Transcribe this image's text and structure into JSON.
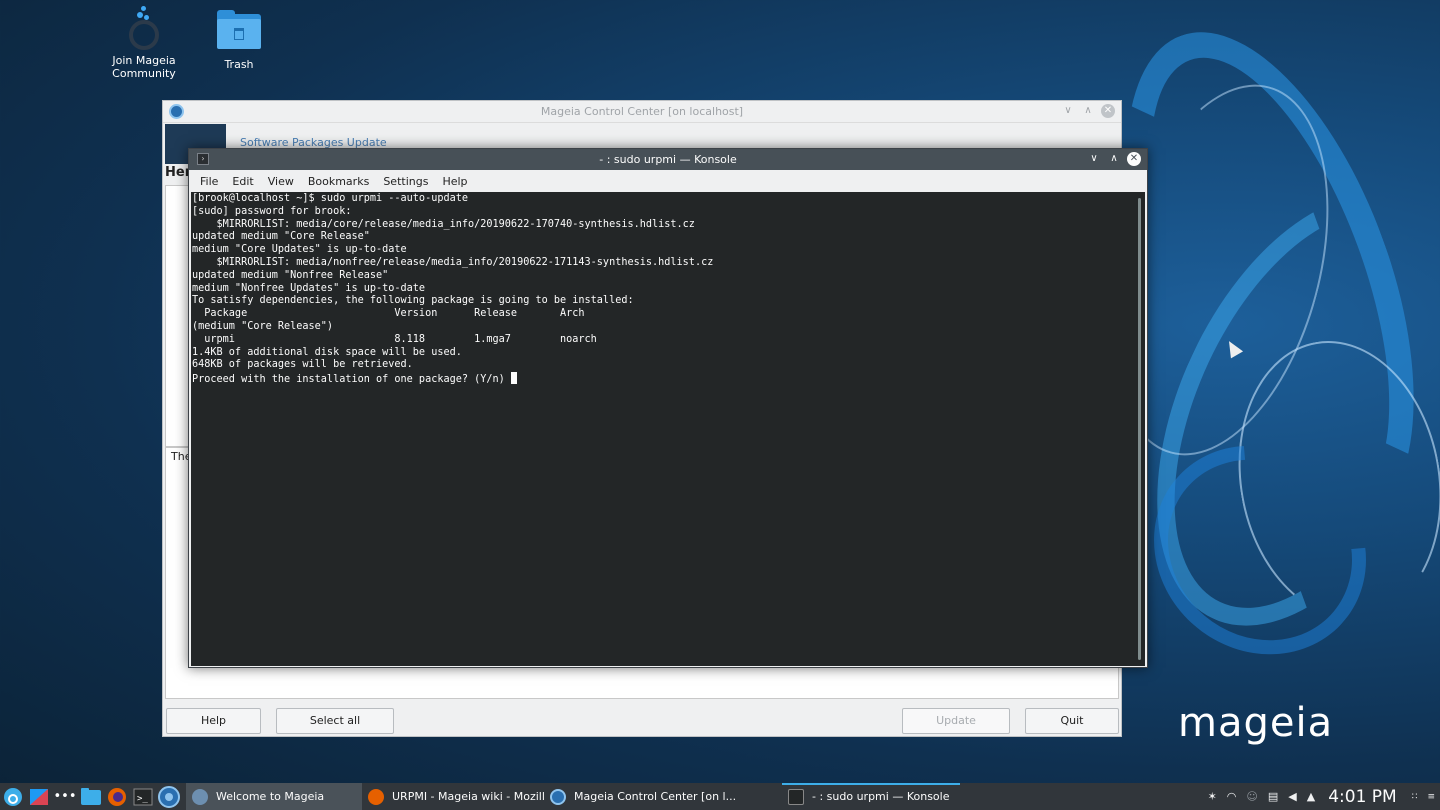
{
  "desktop": {
    "icons": [
      {
        "label_line1": "Join Mageia",
        "label_line2": "Community"
      },
      {
        "label_line1": "Trash"
      }
    ],
    "brand": "mageia"
  },
  "mcc": {
    "title": "Mageia Control Center  [on localhost]",
    "section": "Software Packages Update",
    "heading_partial": "Her",
    "info_partial": "The",
    "buttons": {
      "help": "Help",
      "select_all": "Select all",
      "update": "Update",
      "quit": "Quit"
    }
  },
  "konsole": {
    "title": "- : sudo urpmi — Konsole",
    "menu": [
      "File",
      "Edit",
      "View",
      "Bookmarks",
      "Settings",
      "Help"
    ],
    "lines": [
      "[brook@localhost ~]$ sudo urpmi --auto-update",
      "[sudo] password for brook:",
      "    $MIRRORLIST: media/core/release/media_info/20190622-170740-synthesis.hdlist.cz",
      "updated medium \"Core Release\"",
      "medium \"Core Updates\" is up-to-date",
      "    $MIRRORLIST: media/nonfree/release/media_info/20190622-171143-synthesis.hdlist.cz",
      "updated medium \"Nonfree Release\"",
      "medium \"Nonfree Updates\" is up-to-date",
      "To satisfy dependencies, the following package is going to be installed:",
      "  Package                        Version      Release       Arch",
      "(medium \"Core Release\")",
      "  urpmi                          8.118        1.mga7        noarch",
      "1.4KB of additional disk space will be used.",
      "648KB of packages will be retrieved.",
      "Proceed with the installation of one package? (Y/n) "
    ]
  },
  "taskbar": {
    "tasks": [
      {
        "label": "Welcome to Mageia"
      },
      {
        "label": "URPMI - Mageia wiki - Mozilla..."
      },
      {
        "label": "Mageia Control Center  [on l..."
      },
      {
        "label": "- : sudo urpmi — Konsole"
      }
    ],
    "clock": "4:01 PM"
  },
  "colors": {
    "accent": "#3daee9",
    "terminal_bg": "#232627",
    "titlebar_active": "#475057",
    "taskbar_bg": "#31363b"
  }
}
